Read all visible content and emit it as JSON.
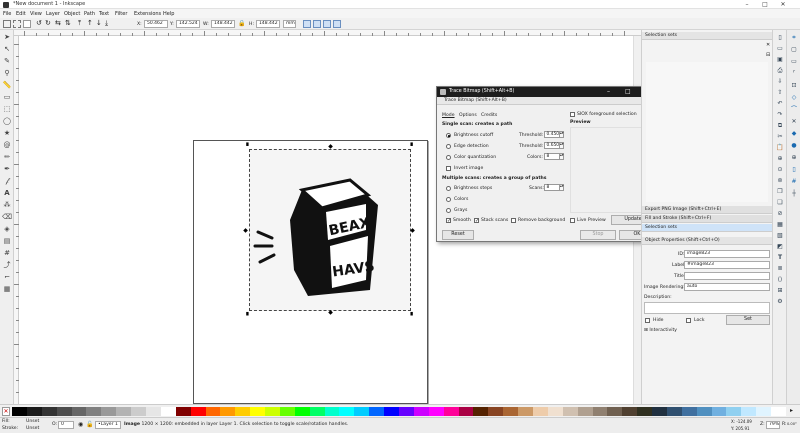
{
  "window": {
    "title": "*New document 1 - Inkscape"
  },
  "menu": [
    "File",
    "Edit",
    "View",
    "Layer",
    "Object",
    "Path",
    "Text",
    "Filter",
    "Extensions",
    "Help"
  ],
  "controls": {
    "x_label": "X:",
    "x": "50.462",
    "y_label": "Y:",
    "y": "142.524",
    "w_label": "W:",
    "w": "148.442",
    "h_label": "H:",
    "h": "148.442",
    "unit": "mm"
  },
  "trace_dialog": {
    "window_title": "Trace Bitmap (Shift+Alt+B)",
    "tab_title": "Trace Bitmap (Shift+Alt+B)",
    "tabs": [
      "Mode",
      "Options",
      "Credits"
    ],
    "single_header": "Single scan: creates a path",
    "brightness_cutoff": "Brightness cutoff",
    "threshold_label": "Threshold:",
    "brightness_threshold": "0.450",
    "edge_detection": "Edge detection",
    "edge_threshold_label": "Threshold:",
    "edge_threshold": "0.650",
    "color_quantization": "Color quantization",
    "colors_label": "Colors:",
    "colors": "8",
    "invert_image": "Invert image",
    "multi_header": "Multiple scans: creates a group of paths",
    "brightness_steps": "Brightness steps",
    "scans_label": "Scans:",
    "scans": "8",
    "colors_opt": "Colors",
    "grays_opt": "Grays",
    "smooth": "Smooth",
    "stack_scans": "Stack scans",
    "remove_background": "Remove background",
    "siox": "SIOX foreground selection",
    "preview_header": "Preview",
    "live_preview": "Live Preview",
    "update": "Update",
    "reset": "Reset",
    "stop": "Stop",
    "ok": "OK"
  },
  "dock": {
    "selection_sets_title": "Selection sets",
    "export_png": "Export PNG Image (Shift+Ctrl+E)",
    "fill_stroke": "Fill and Stroke (Shift+Ctrl+F)",
    "selection_sets_item": "Selection sets",
    "object_properties": "Object Properties (Shift+Ctrl+O)",
    "id_label": "ID:",
    "id_value": "image823",
    "label_label": "Label:",
    "label_value": "#image823",
    "title_label": "Title:",
    "title_value": "",
    "rendering_label": "Image Rendering:",
    "rendering_value": "auto",
    "description_label": "Description:",
    "hide": "Hide",
    "lock": "Lock",
    "set": "Set",
    "interactivity": "Interactivity"
  },
  "status": {
    "fill_label": "Fill:",
    "fill_value": "Unset",
    "stroke_label": "Stroke:",
    "stroke_value": "Unset",
    "opacity_label": "O:",
    "opacity": "0",
    "layer": "•Layer 1",
    "message_bold": "Image",
    "message": " 1200 × 1200: embedded in layer Layer 1. Click selection to toggle scale/rotation handles.",
    "coords_x": "X: -124.09",
    "coords_y": "Y: 205.91",
    "zoom_label": "Z:",
    "zoom": "79%",
    "rotation_label": "R:",
    "rotation": "0.00°"
  },
  "artwork": {
    "top_text": "BEAX",
    "bottom_text": "HAVS"
  },
  "palette_colors": [
    "#000000",
    "#1a1a1a",
    "#333333",
    "#4d4d4d",
    "#666666",
    "#808080",
    "#999999",
    "#b3b3b3",
    "#cccccc",
    "#e6e6e6",
    "#ffffff",
    "#800000",
    "#ff0000",
    "#ff6600",
    "#ff9900",
    "#ffcc00",
    "#ffff00",
    "#ccff00",
    "#66ff00",
    "#00ff00",
    "#00ff66",
    "#00ffcc",
    "#00ffff",
    "#00ccff",
    "#0066ff",
    "#0000ff",
    "#6600ff",
    "#cc00ff",
    "#ff00ff",
    "#ff0099",
    "#aa0044",
    "#552200",
    "#884422",
    "#aa6633",
    "#cc9966",
    "#eeccaa",
    "#f0e0d0",
    "#d0c0b0",
    "#b0a090",
    "#908070",
    "#706050",
    "#504030",
    "#303020",
    "#203040",
    "#305070",
    "#4070a0",
    "#5090c0",
    "#70b0e0",
    "#90d0f0",
    "#c0e8ff",
    "#e0f4ff",
    "#ffffff"
  ]
}
